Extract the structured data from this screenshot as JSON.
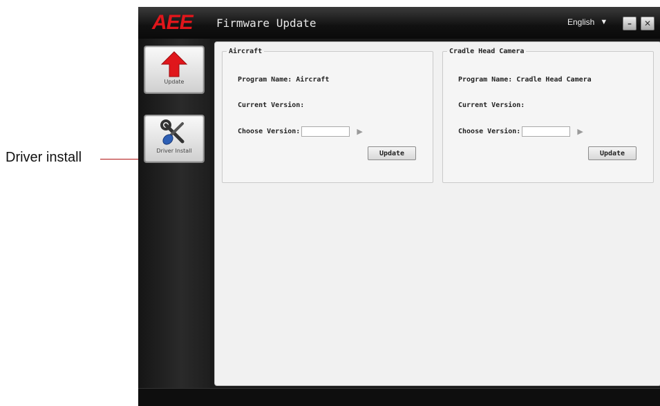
{
  "annotation": {
    "label": "Driver install"
  },
  "window": {
    "logo": "AEE",
    "title": "Firmware Update",
    "language": "English",
    "minimize_glyph": "–",
    "close_glyph": "✕"
  },
  "sidebar": {
    "items": [
      {
        "label": "Update",
        "icon": "red-up-arrow-icon"
      },
      {
        "label": "Driver Install",
        "icon": "wrench-screwdriver-icon"
      }
    ]
  },
  "panels": {
    "aircraft": {
      "legend": "Aircraft",
      "program_name": "Program Name: Aircraft",
      "current_version": "Current Version:",
      "choose_version": "Choose Version:",
      "choose_value": "",
      "update_label": "Update"
    },
    "camera": {
      "legend": "Cradle Head Camera",
      "program_name": "Program Name: Cradle Head Camera",
      "current_version": "Current Version:",
      "choose_version": "Choose Version:",
      "choose_value": "",
      "update_label": "Update"
    }
  },
  "colors": {
    "brand_red": "#e0161b",
    "window_dark": "#1a1a1a",
    "panel_bg": "#f1f1f1"
  }
}
